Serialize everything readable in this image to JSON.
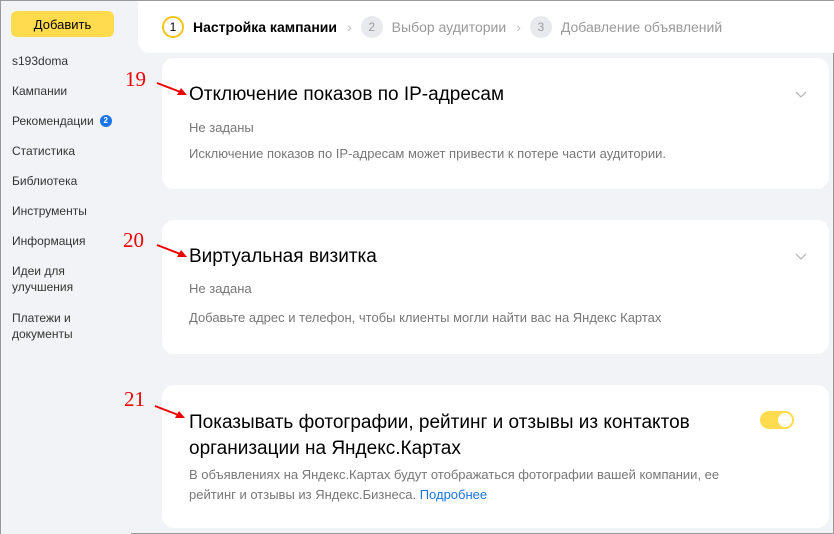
{
  "sidebar": {
    "add_button": "Добавить",
    "items": [
      {
        "label": "s193doma"
      },
      {
        "label": "Кампании"
      },
      {
        "label": "Рекомендации",
        "badge": "2"
      },
      {
        "label": "Статистика"
      },
      {
        "label": "Библиотека"
      },
      {
        "label": "Инструменты"
      },
      {
        "label": "Информация"
      },
      {
        "label": "Идеи для улучшения"
      },
      {
        "label": "Платежи и документы"
      }
    ]
  },
  "stepper": {
    "steps": [
      {
        "num": "1",
        "label": "Настройка кампании",
        "state": "active"
      },
      {
        "num": "2",
        "label": "Выбор аудитории",
        "state": "inactive"
      },
      {
        "num": "3",
        "label": "Добавление объявлений",
        "state": "inactive"
      }
    ]
  },
  "cards": [
    {
      "annotation": "19",
      "title": "Отключение показов по IP-адресам",
      "status": "Не заданы",
      "description": "Исключение показов по IP-адресам может привести к потере части аудитории."
    },
    {
      "annotation": "20",
      "title": "Виртуальная визитка",
      "status": "Не задана",
      "description": "Добавьте адрес и телефон, чтобы клиенты могли найти вас на Яндекс Картах"
    },
    {
      "annotation": "21",
      "title_line1": "Показывать фотографии, рейтинг и отзывы из контактов",
      "title_line2": "организации на Яндекс.Картах",
      "description_line1": "В объявлениях на Яндекс.Картах будут отображаться фотографии вашей компании, ее",
      "description_line2": "рейтинг и отзывы из Яндекс.Бизнеса.",
      "link": "Подробнее",
      "toggle_on": true
    }
  ],
  "colors": {
    "accent_yellow": "#ffdb4d",
    "annotation_red": "#ee0000",
    "link_blue": "#1a73e8",
    "page_bg": "#f2f3f6"
  }
}
